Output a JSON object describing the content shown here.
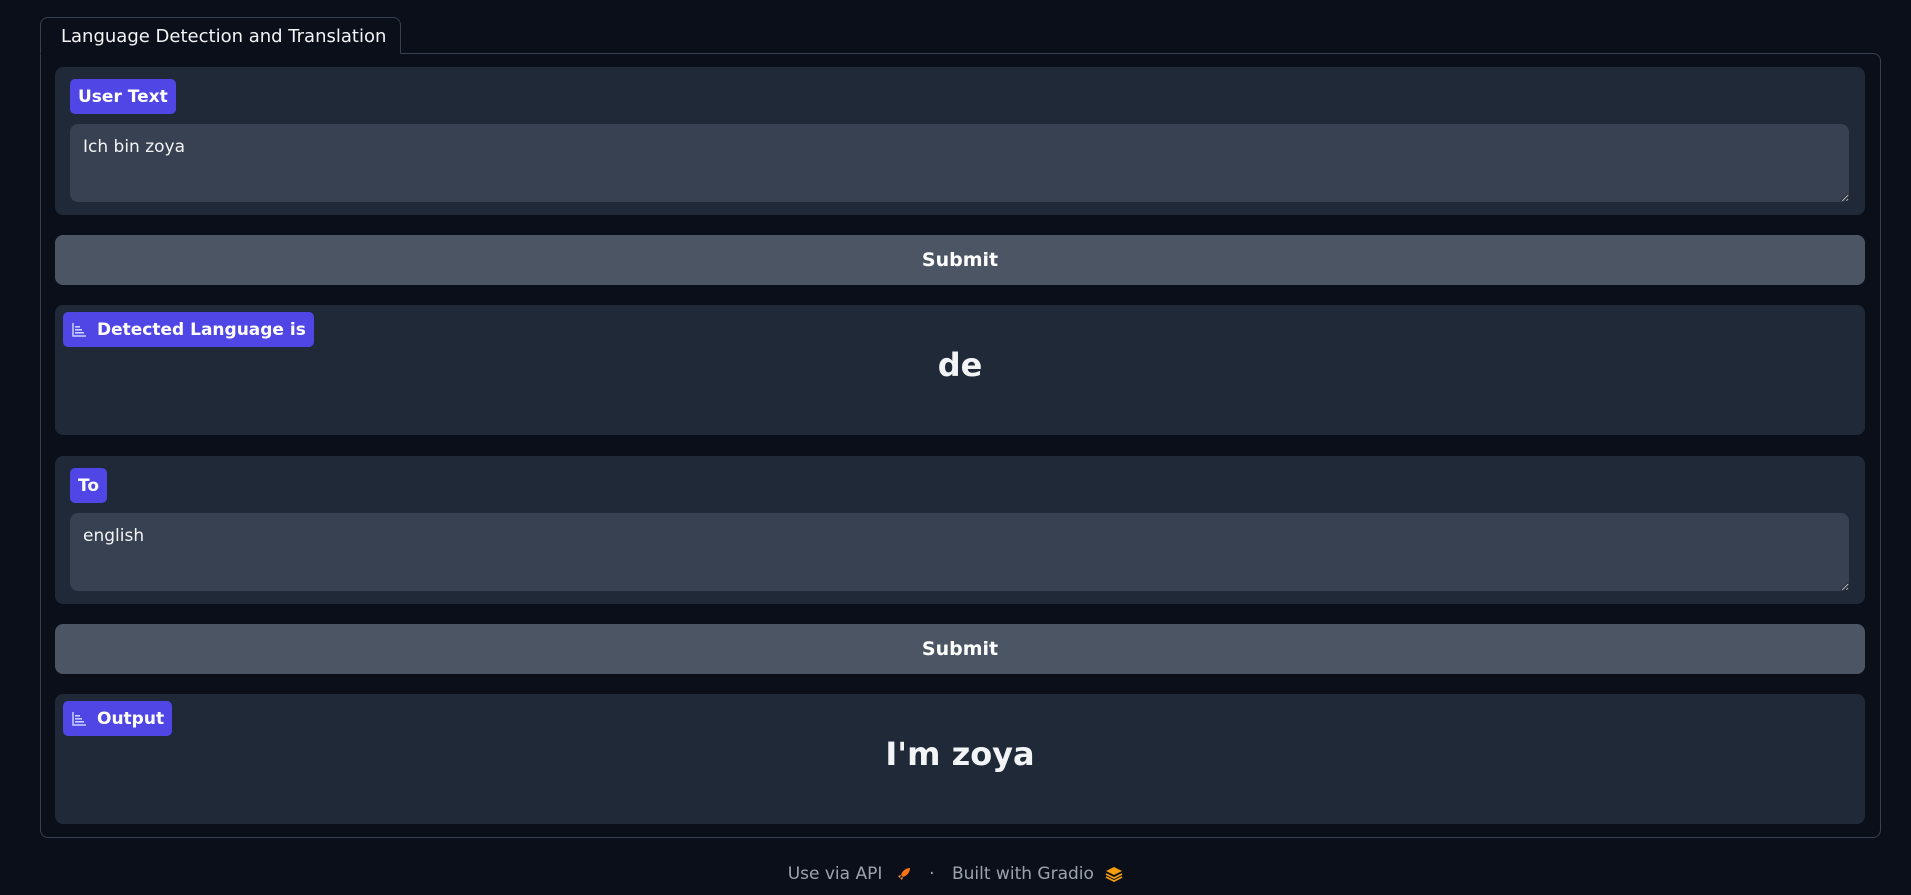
{
  "tab": {
    "label": "Language Detection and Translation"
  },
  "user_text": {
    "label": "User Text",
    "value": "Ich bin zoya"
  },
  "submit_1": {
    "label": "Submit"
  },
  "detected": {
    "label": "Detected Language is",
    "value": "de"
  },
  "to": {
    "label": "To",
    "value": "english"
  },
  "submit_2": {
    "label": "Submit"
  },
  "output": {
    "label": "Output",
    "value": "I'm zoya"
  },
  "footer": {
    "api": "Use via API",
    "separator": "·",
    "built": "Built with Gradio"
  },
  "colors": {
    "accent": "#4f46e5",
    "background": "#0b0f19",
    "block": "#1f2937",
    "input": "#374151",
    "button": "#4b5563"
  }
}
